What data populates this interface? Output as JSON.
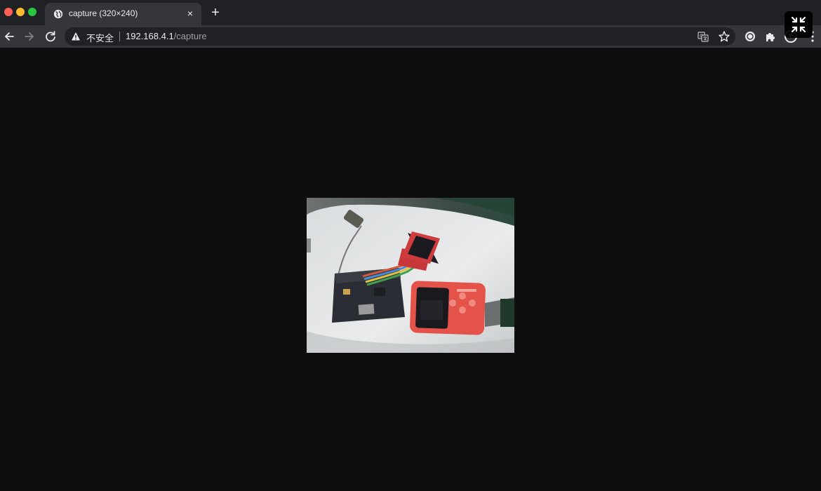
{
  "browser": {
    "tab": {
      "title": "capture (320×240)",
      "favicon": "globe-icon",
      "close_symbol": "×"
    },
    "new_tab_symbol": "+",
    "omnibox": {
      "security_icon": "warning-icon",
      "security_label": "不安全",
      "url_host": "192.168.4.1",
      "url_path": "/capture"
    },
    "colors": {
      "tabstrip": "#202124",
      "toolbar": "#35363a",
      "page_background": "#0e0e0e"
    }
  },
  "page": {
    "image": {
      "description_icon": "camera-capture-image"
    }
  }
}
